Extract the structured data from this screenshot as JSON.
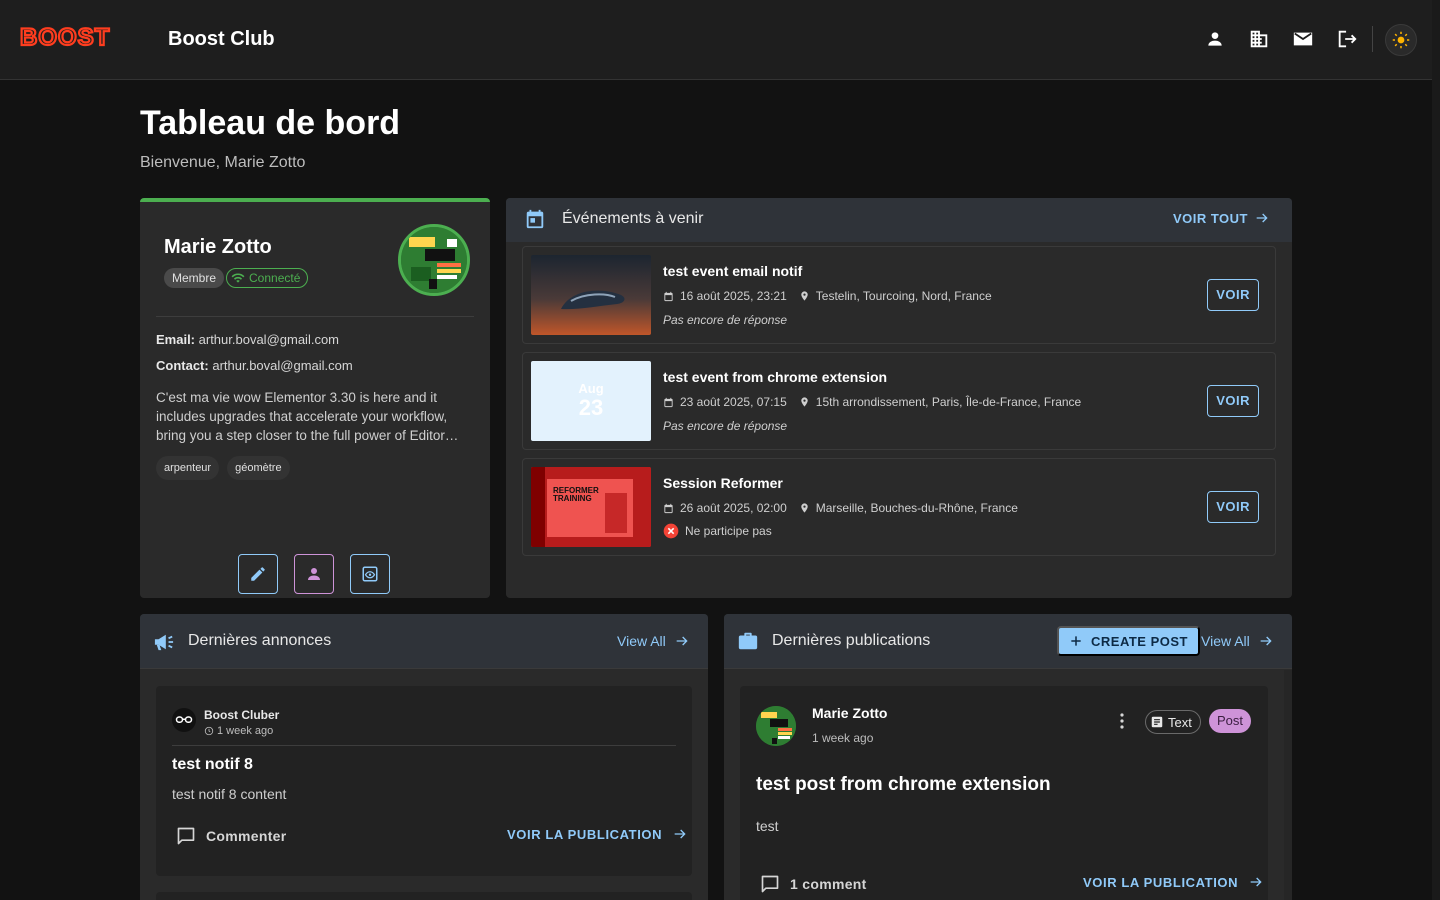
{
  "app": {
    "logo_text": "BOOST",
    "club_name": "Boost Club"
  },
  "nav": {
    "icons": [
      "person-icon",
      "building-icon",
      "mail-icon",
      "logout-icon"
    ],
    "theme_icon": "sun-icon"
  },
  "page": {
    "title": "Tableau de bord",
    "welcome": "Bienvenue, Marie Zotto"
  },
  "profile": {
    "name": "Marie Zotto",
    "role": "Membre",
    "status": "Connecté",
    "email_label": "Email:",
    "email": "arthur.boval@gmail.com",
    "contact_label": "Contact:",
    "contact": "arthur.boval@gmail.com",
    "bio": "C'est ma vie wow Elementor 3.30 is here and it includes upgrades that accelerate your workflow, bring you a step closer to the full power of Editor…",
    "tags": [
      "arpenteur",
      "géomètre"
    ],
    "accent_color": "#4caf50"
  },
  "events": {
    "title": "Événements à venir",
    "see_all": "VOIR TOUT",
    "items": [
      {
        "title": "test event email notif",
        "date": "16 août 2025, 23:21",
        "location": "Testelin, Tourcoing, Nord, France",
        "status": "Pas encore de réponse",
        "action": "VOIR"
      },
      {
        "title": "test event from chrome extension",
        "thumb_month": "Aug",
        "thumb_day": "23",
        "date": "23 août 2025, 07:15",
        "location": "15th arrondissement, Paris, Île-de-France, France",
        "status": "Pas encore de réponse",
        "action": "VOIR"
      },
      {
        "title": "Session Reformer",
        "thumb_text": "REFORMER TRAINING",
        "date": "26 août 2025, 02:00",
        "location": "Marseille, Bouches-du-Rhône, France",
        "status": "Ne participe pas",
        "action": "VOIR"
      }
    ]
  },
  "announcements": {
    "title": "Dernières annonces",
    "view_all": "View All",
    "items": [
      {
        "author": "Boost Cluber",
        "time": "1 week ago",
        "title": "test notif 8",
        "content": "test notif 8 content",
        "comment_label": "Commenter",
        "view_label": "VOIR LA PUBLICATION"
      }
    ]
  },
  "publications": {
    "title": "Dernières publications",
    "create_label": "CREATE POST",
    "view_all": "View All",
    "items": [
      {
        "author": "Marie Zotto",
        "time": "1 week ago",
        "type_chip": "Text",
        "kind_chip": "Post",
        "title": "test post from chrome extension",
        "body": "test",
        "comments": "1 comment",
        "view_label": "VOIR LA PUBLICATION"
      }
    ]
  },
  "colors": {
    "primary": "#90caf9",
    "brand": "#ff3d1f",
    "success": "#4caf50",
    "error": "#f44336",
    "post_chip": "#ce93d8"
  }
}
